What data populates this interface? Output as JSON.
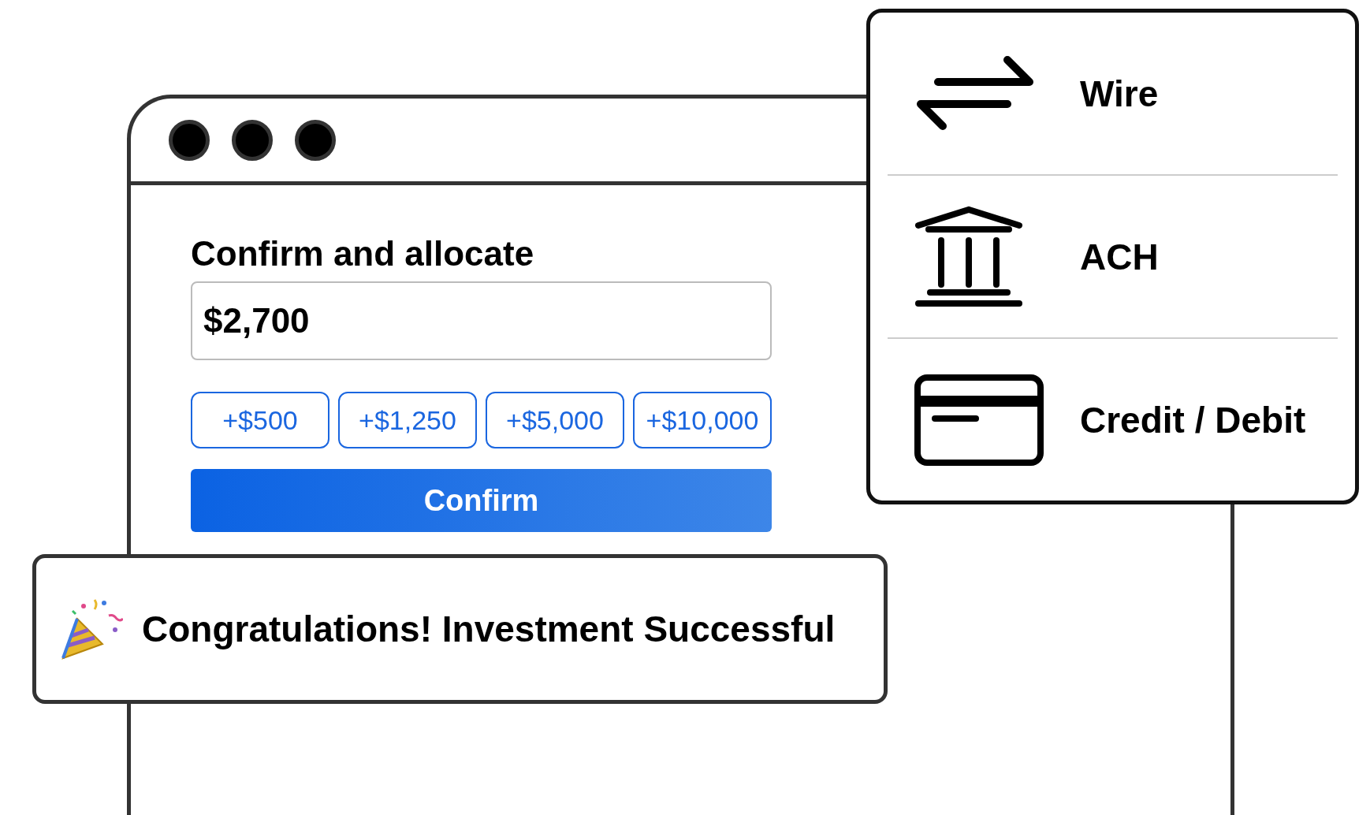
{
  "browser": {
    "heading": "Confirm and allocate",
    "amount": "$2,700",
    "chips": [
      "+$500",
      "+$1,250",
      "+$5,000",
      "+$10,000"
    ],
    "confirm_button": "Confirm"
  },
  "toast": {
    "message": "Congratulations! Investment Successful"
  },
  "payment_methods": [
    {
      "kind": "wire",
      "label": "Wire"
    },
    {
      "kind": "ach",
      "label": "ACH"
    },
    {
      "kind": "card",
      "label": "Credit / Debit"
    }
  ]
}
